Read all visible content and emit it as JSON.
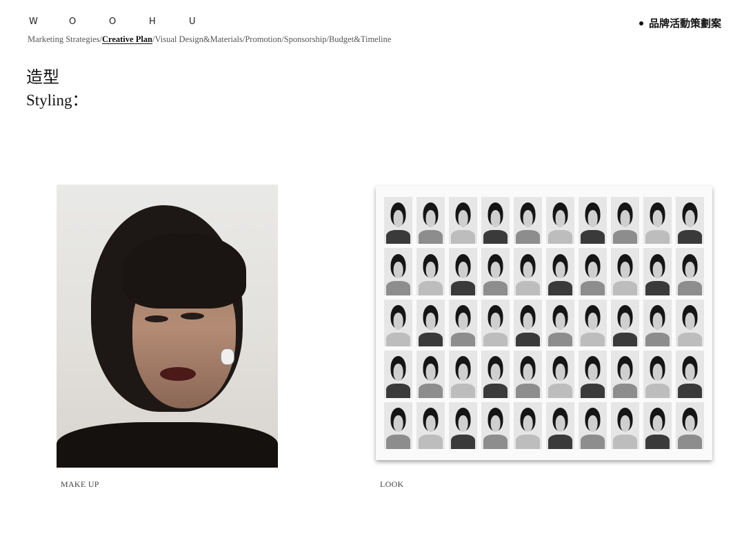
{
  "header": {
    "logo_letters": [
      "W",
      "O",
      "O",
      "H",
      "U"
    ],
    "brand_title": "品牌活動策劃案"
  },
  "nav": {
    "items": [
      {
        "label": "Marketing Strategies",
        "active": false
      },
      {
        "label": "Creative Plan",
        "active": true
      },
      {
        "label": "Visual Design&Materials",
        "active": false
      },
      {
        "label": "Promotion",
        "active": false
      },
      {
        "label": "Sponsorship",
        "active": false
      },
      {
        "label": "Budget&Timeline",
        "active": false
      }
    ],
    "separator": "/"
  },
  "section": {
    "title_zh": "造型",
    "title_en": "Styling："
  },
  "gallery": {
    "makeup_caption": "MAKE UP",
    "look_caption": "LOOK"
  }
}
